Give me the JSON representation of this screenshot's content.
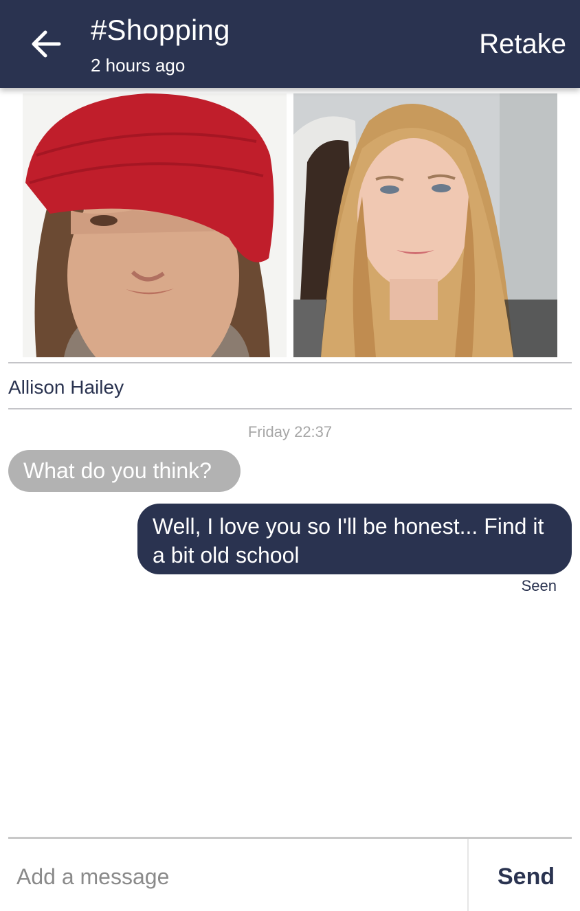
{
  "header": {
    "title": "#Shopping",
    "subtitle": "2 hours ago",
    "retake_label": "Retake",
    "back_icon": "arrow-left-icon"
  },
  "colors": {
    "primary": "#2a3350",
    "incoming_bubble": "#b2b2b2",
    "hat_red": "#c01e2b"
  },
  "photos": [
    {
      "alt": "woman in red knit beanie"
    },
    {
      "alt": "woman with long blonde hair"
    }
  ],
  "post": {
    "author": "Allison Hailey"
  },
  "chat": {
    "timestamp": "Friday 22:37",
    "messages": [
      {
        "direction": "incoming",
        "text": "What do you think?"
      },
      {
        "direction": "outgoing",
        "text": "Well, I love you so I'll be honest... Find it a bit old school"
      }
    ],
    "status": "Seen"
  },
  "composer": {
    "placeholder": "Add a message",
    "value": "",
    "send_label": "Send"
  }
}
